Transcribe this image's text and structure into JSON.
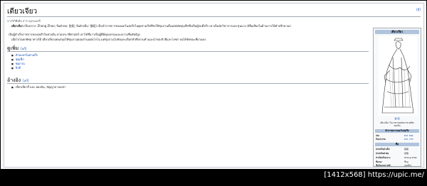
{
  "page": {
    "title": "เตียวเจียว",
    "edit_top": "[มี]",
    "subtitle": "จากวิกิพีเดีย สารานุกรมเสรี",
    "intro_bold": "เตียวเจียว",
    "intro_1": " (จีนกลาง: Zhang Zhao; จีนตัวย่อ: 张昭; จีนตัวเต็ม: 張昭) เป็นข้าราชการของแคว้นง่อก๊กในยุคสามก๊กที่รับใช้ซุนกวนตั้งแต่สมัยซุนเซ็กซึ่งเป็นผู้ก่อตั้งก๊ก เขาเป็นนักวิชาการและขุนนาง มีชื่อเสียงในด้านการให้คำปรึกษาแก่",
    "intro_2": "เป็นผู้สำเร็จราชการของง่อก๊กในช่วงต้น ตามประวัติศาสตร์ เขาได้ชื่อว่าเป็นผู้ที่มีคุณธรรมและความซื่อสัตย์สูง",
    "intro_3": "เมื่อโจโฉยกทัพมาทางใต้ เตียวเจียวเคยเสนอให้ซุนกวนยอมจำนนต่อโจโฉ แต่ซุนกวนไม่ฟังและเลือกทำศึกตามคำแนะนำของจิวยี่และโลซก จนได้ชัยชนะที่ผาแดง",
    "sec1": "ดูเพิ่ม",
    "sec1_edit": "[แก้]",
    "sec1_items": [
      "ตัวละครในสามก๊ก",
      "ซุนเซ็ก",
      "ซุนกวน",
      "จิวยี่"
    ],
    "sec2": "อ้างอิง",
    "sec2_edit": "[แก้]",
    "sec2_items": [
      "เจี่ยวเจียวกี๋ และ ผ่องหัน, ปัญญาบางเปล่า"
    ]
  },
  "infobox": {
    "head": "เตียวเจียว",
    "sig": "張 昭",
    "caption_1": "เตียวเจียว ในภาพวาดสมัยราชวงศ์ชิง",
    "caption_2": "ของจีน",
    "bar1": "ข้าราชการแคว้นง่อก๊ก",
    "rows1": [
      {
        "k": "เกิด",
        "v": "พ.ศ. 699"
      },
      {
        "k": "ถึงแก่กรรม",
        "v": "พ.ศ. 779"
      }
    ],
    "bar2": "ชื่อ",
    "rows2": [
      {
        "k": "อักษรจีนตัวเต็ม",
        "v": "張昭"
      },
      {
        "k": "อักษรจีนตัวย่อ",
        "v": "张昭"
      },
      {
        "k": "สำเนียงจีนกลาง",
        "v": "Zhāng Zhāo"
      },
      {
        "k": "ชื่อรอง",
        "v": "ชื่อจู"
      },
      {
        "k": "ชื่อในเกมสามก๊ก",
        "v": "บุนเตียว"
      }
    ]
  },
  "watermark": "[1412x568] https://upic.me/"
}
